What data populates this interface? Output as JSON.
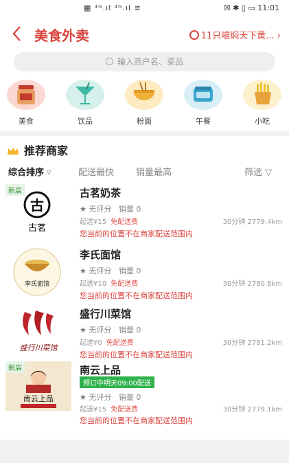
{
  "status_bar": {
    "signal": "▦ ⁴ᴳ.ıl ⁴ᴳ.ıl ≋",
    "icons": "☒ ✱ ▯ ▭",
    "time": "11:01"
  },
  "header": {
    "title": "美食外卖",
    "location": "11只喵焖天下黄..."
  },
  "search": {
    "placeholder": "输入商户名、菜品"
  },
  "categories": [
    {
      "label": "美食",
      "icon": "jam-jar-icon",
      "color": "#fbd9d2"
    },
    {
      "label": "饮品",
      "icon": "cocktail-icon",
      "color": "#d6f1ec"
    },
    {
      "label": "粉面",
      "icon": "noodle-bowl-icon",
      "color": "#fdecc2"
    },
    {
      "label": "午餐",
      "icon": "lunchbox-icon",
      "color": "#d8eef6"
    },
    {
      "label": "小吃",
      "icon": "fries-icon",
      "color": "#fdf0cd"
    }
  ],
  "section": {
    "title": "推荐商家"
  },
  "sort": {
    "default": "综合排序",
    "fastest": "配送最快",
    "top_sales": "销量最高",
    "filter": "筛选"
  },
  "stores": [
    {
      "name": "古茗奶茶",
      "new_tag": "新店",
      "rating": "无评分",
      "sales": "销量 0",
      "fee": "起送¥15",
      "free": "免配送费",
      "dist": "30分钟 2779.4km",
      "warn": "您当前的位置不在商家配送范围内",
      "logo_text": "古茗"
    },
    {
      "name": "李氏面馆",
      "rating": "无评分",
      "sales": "销量 0",
      "fee": "起送¥10",
      "free": "免配送费",
      "dist": "30分钟 2780.8km",
      "warn": "您当前的位置不在商家配送范围内",
      "logo_text": "李氏面馆"
    },
    {
      "name": "盛行川菜馆",
      "rating": "无评分",
      "sales": "销量 0",
      "fee": "起送¥0",
      "free": "免配送费",
      "dist": "30分钟 2781.2km",
      "warn": "您当前的位置不在商家配送范围内",
      "logo_text": "盛行川菜馆"
    },
    {
      "name": "南云上品",
      "new_tag": "新店",
      "preorder": "预订中明天09:00配送",
      "rating": "无评分",
      "sales": "销量 0",
      "fee": "起送¥15",
      "free": "免配送费",
      "dist": "30分钟 2779.1km",
      "warn": "您当前的位置不在商家配送范围内",
      "logo_text": "南云上品"
    }
  ],
  "colors": {
    "accent": "#d9463f",
    "green": "#2fb24c"
  }
}
